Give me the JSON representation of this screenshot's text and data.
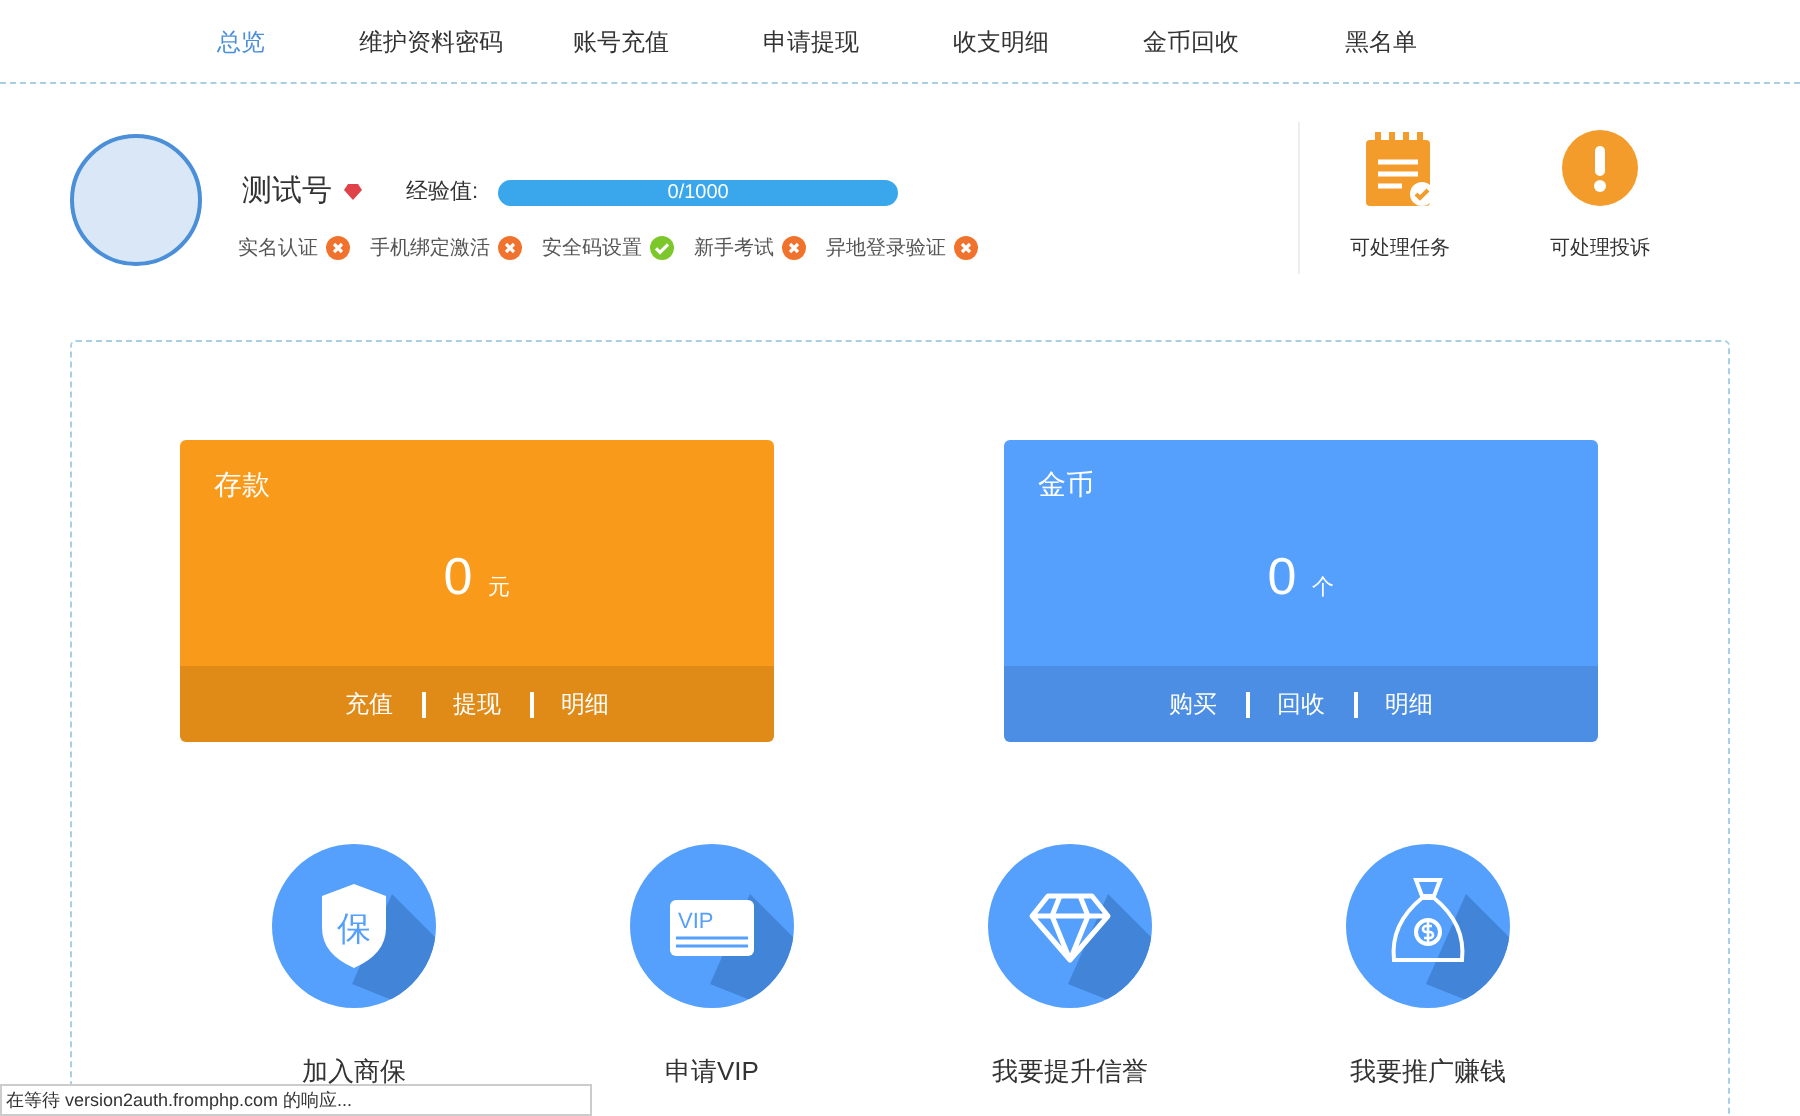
{
  "nav": [
    {
      "label": "总览",
      "selected": true
    },
    {
      "label": "维护资料密码",
      "selected": false
    },
    {
      "label": "账号充值",
      "selected": false
    },
    {
      "label": "申请提现",
      "selected": false
    },
    {
      "label": "收支明细",
      "selected": false
    },
    {
      "label": "金币回收",
      "selected": false
    },
    {
      "label": "黑名单",
      "selected": false
    }
  ],
  "profile": {
    "name": "测试号",
    "exp_label": "经验值:",
    "exp_text": "0/1000",
    "exp": {
      "level": 0
    },
    "verifications": [
      {
        "label": "实名认证",
        "verified": false
      },
      {
        "label": "手机绑定激活",
        "verified": false
      },
      {
        "label": "安全码设置",
        "verified": true
      },
      {
        "label": "新手考试",
        "verified": false
      },
      {
        "label": "异地登录验证",
        "verified": false
      }
    ]
  },
  "shortcuts": [
    {
      "kind": "task",
      "label": "可处理任务"
    },
    {
      "kind": "complaint",
      "label": "可处理投诉"
    }
  ],
  "cards": [
    {
      "title": "存款",
      "amount": "0",
      "unit": "元",
      "color": "#fa9a1a",
      "actions": [
        "充值",
        "提现",
        "明细"
      ]
    },
    {
      "title": "金币",
      "amount": "0",
      "unit": "个",
      "color": "#559ffd",
      "actions": [
        "购买",
        "回收",
        "明细"
      ]
    }
  ],
  "features": [
    {
      "kind": "shield",
      "icon_text": "保",
      "label": "加入商保"
    },
    {
      "kind": "vip",
      "icon_text": "VIP",
      "label": "申请VIP"
    },
    {
      "kind": "diamond",
      "label": "我要提升信誉"
    },
    {
      "kind": "moneybag",
      "label": "我要推广赚钱"
    }
  ],
  "status_bar": "在等待 version2auth.fromphp.com 的响应..."
}
